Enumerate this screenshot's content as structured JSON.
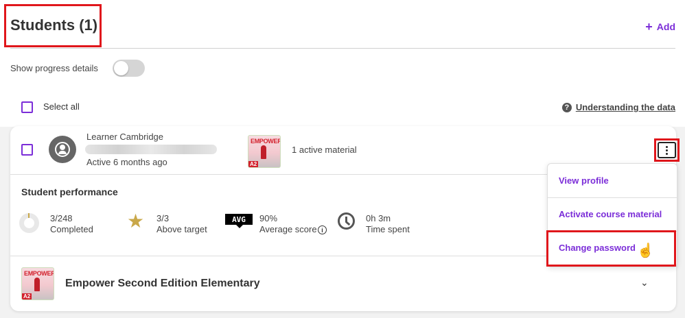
{
  "header": {
    "title": "Students (1)",
    "add_label": "Add"
  },
  "progress": {
    "label": "Show progress details",
    "toggle_on": false
  },
  "select_all": {
    "label": "Select all"
  },
  "help_link": {
    "label": "Understanding the data",
    "icon": "question-circle-icon"
  },
  "student": {
    "name": "Learner Cambridge",
    "last_active": "Active 6 months ago",
    "material_count": "1 active material",
    "book_cover_title": "EMPOWER",
    "book_level": "A2"
  },
  "performance": {
    "title": "Student performance",
    "stats": [
      {
        "value": "3/248",
        "label": "Completed",
        "icon": "donut-progress-icon"
      },
      {
        "value": "3/3",
        "label": "Above target",
        "icon": "star-icon"
      },
      {
        "value": "90%",
        "label": "Average score",
        "icon": "avg-icon",
        "icon_text": "AVG"
      },
      {
        "value": "0h 3m",
        "label": "Time spent",
        "icon": "clock-icon"
      }
    ]
  },
  "course": {
    "title": "Empower Second Edition Elementary"
  },
  "menu": {
    "items": [
      {
        "label": "View profile"
      },
      {
        "label": "Activate course material"
      },
      {
        "label": "Change password"
      }
    ]
  },
  "colors": {
    "accent": "#7b2dd8",
    "highlight": "#e0161b",
    "star": "#c9a84a"
  }
}
